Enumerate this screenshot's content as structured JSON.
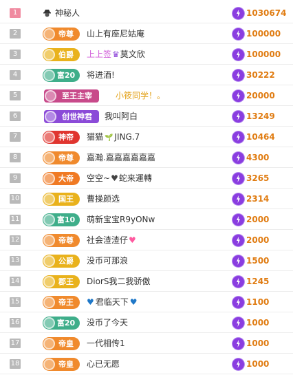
{
  "colors": {
    "amount": "#e07c12",
    "coin": "#8a3de0",
    "rank_first": "#f08aa0",
    "rank": "#b9b9b9"
  },
  "rows": [
    {
      "rank": "1",
      "badge": "",
      "badge_color": "",
      "name": "神秘人",
      "amount": "1030674",
      "icon": "spy-icon"
    },
    {
      "rank": "2",
      "badge": "帝尊",
      "badge_color": "#f08a2d",
      "name": "山上有座尼姑庵",
      "amount": "100000"
    },
    {
      "rank": "3",
      "badge": "伯爵",
      "badge_color": "#e9b21c",
      "name": "上上签",
      "amount": "100000",
      "name2": "莫文欣",
      "special": true
    },
    {
      "rank": "4",
      "badge": "富20",
      "badge_color": "#3fae8a",
      "name": "将进酒!",
      "amount": "30222"
    },
    {
      "rank": "5",
      "badge": "至王主宰",
      "badge_color": "#c84a8a",
      "name": "小筱同学！。",
      "amount": "20000",
      "wide": true,
      "gold": true
    },
    {
      "rank": "6",
      "badge": "创世神君",
      "badge_color": "#8b4bd8",
      "name": "我叫阿白",
      "amount": "13249",
      "wide": true
    },
    {
      "rank": "7",
      "badge": "神帝",
      "badge_color": "#e0352f",
      "name": "猫猫",
      "amount": "10464",
      "name2": "JING.7"
    },
    {
      "rank": "8",
      "badge": "帝尊",
      "badge_color": "#f08a2d",
      "name": "嘉瀚.嘉嘉嘉嘉嘉嘉",
      "amount": "4300"
    },
    {
      "rank": "9",
      "badge": "大帝",
      "badge_color": "#f07a24",
      "name": "空空~",
      "amount": "3265",
      "name2": "蛇来運轉"
    },
    {
      "rank": "10",
      "badge": "国王",
      "badge_color": "#e9b21c",
      "name": "曹操颜选",
      "amount": "2314"
    },
    {
      "rank": "11",
      "badge": "富10",
      "badge_color": "#3fae8a",
      "name": "萌新宝宝R9yONw",
      "amount": "2000"
    },
    {
      "rank": "12",
      "badge": "帝尊",
      "badge_color": "#f08a2d",
      "name": "社会渣渣仔",
      "amount": "2000"
    },
    {
      "rank": "13",
      "badge": "公爵",
      "badge_color": "#e9b21c",
      "name": "没币可那浪",
      "amount": "1500"
    },
    {
      "rank": "14",
      "badge": "郡王",
      "badge_color": "#e9b21c",
      "name": "DiorS我二我骄傲",
      "amount": "1245"
    },
    {
      "rank": "15",
      "badge": "帝王",
      "badge_color": "#f08a2d",
      "name": "君临天下",
      "amount": "1100"
    },
    {
      "rank": "16",
      "badge": "富20",
      "badge_color": "#3fae8a",
      "name": "没币了今天",
      "amount": "1000"
    },
    {
      "rank": "17",
      "badge": "帝皇",
      "badge_color": "#f08a2d",
      "name": "一代相传1",
      "amount": "1000"
    },
    {
      "rank": "18",
      "badge": "帝皇",
      "badge_color": "#f08a2d",
      "name": "心已无愿",
      "amount": "1000"
    }
  ]
}
